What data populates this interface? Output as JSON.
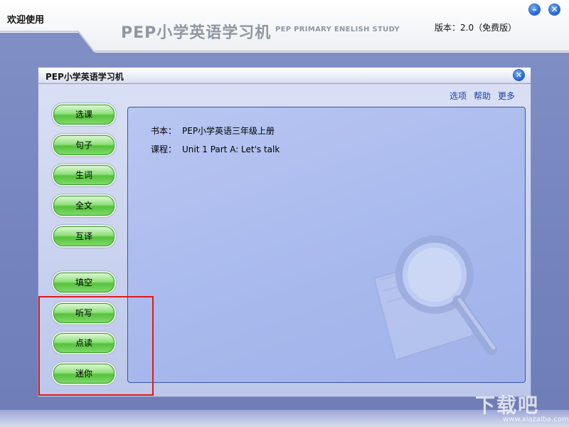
{
  "header": {
    "welcome": "欢迎使用",
    "logo_main": "PEP小学英语学习机",
    "logo_sub": "PEP PRIMARY ENELISH STUDY",
    "version": "版本：2.0（免费版）",
    "minimize_label": "–",
    "close_label": "✕"
  },
  "window": {
    "title": "PEP小学英语学习机",
    "close_label": "✕",
    "menu": [
      "选项",
      "帮助",
      "更多"
    ]
  },
  "sidebar": {
    "buttons": [
      "选课",
      "句子",
      "生词",
      "全文",
      "互译",
      "填空",
      "听写",
      "点读",
      "迷你"
    ]
  },
  "content": {
    "book_label": "书本：",
    "book_value": "PEP小学英语三年级上册",
    "course_label": "课程：",
    "course_value": "Unit 1 Part A: Let's talk"
  },
  "watermark": {
    "text": "下载吧",
    "url": "www.xiazaiba.com"
  },
  "colors": {
    "desk": "#7382bd",
    "panel": "#a7b8ed",
    "button_green": "#56c23c",
    "highlight": "#e01a1a",
    "link": "#1a3fa8"
  }
}
